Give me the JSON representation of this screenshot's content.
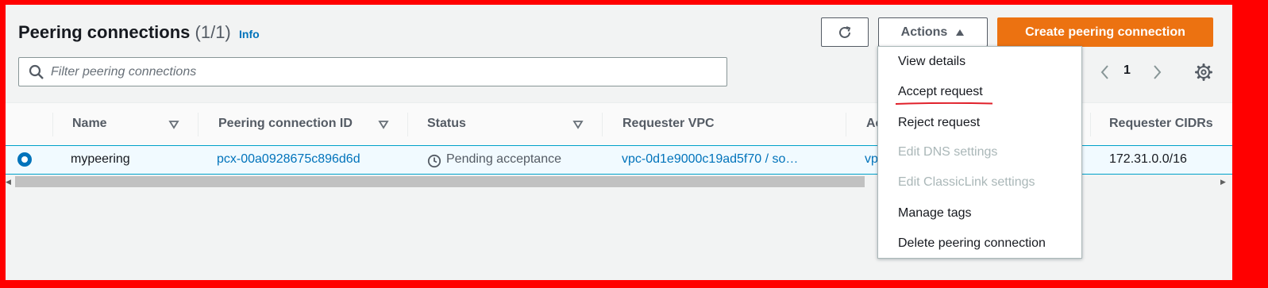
{
  "header": {
    "title": "Peering connections",
    "count": "(1/1)",
    "info_label": "Info"
  },
  "toolbar": {
    "refresh_icon": "refresh-icon",
    "actions_label": "Actions",
    "create_label": "Create peering connection"
  },
  "search": {
    "placeholder": "Filter peering connections"
  },
  "pager": {
    "page": "1"
  },
  "table": {
    "columns": [
      "Name",
      "Peering connection ID",
      "Status",
      "Requester VPC",
      "Ac",
      "Requester CIDRs"
    ],
    "rows": [
      {
        "name": "mypeering",
        "peering_id": "pcx-00a0928675c896d6d",
        "status": "Pending acceptance",
        "requester_vpc": "vpc-0d1e9000c19ad5f70 / so…",
        "accepter_vpc": "vp",
        "requester_cidrs": "172.31.0.0/16",
        "selected": true
      }
    ]
  },
  "actions_menu": {
    "items": [
      {
        "label": "View details",
        "disabled": false
      },
      {
        "label": "Accept request",
        "disabled": false
      },
      {
        "label": "Reject request",
        "disabled": false
      },
      {
        "label": "Edit DNS settings",
        "disabled": true
      },
      {
        "label": "Edit ClassicLink settings",
        "disabled": true
      },
      {
        "label": "Manage tags",
        "disabled": false
      },
      {
        "label": "Delete peering connection",
        "disabled": false
      }
    ]
  },
  "colors": {
    "accent": "#0073bb",
    "primary_button": "#ec7211",
    "annotation_border": "#ff0000",
    "annotation_underline": "#e0202a"
  }
}
